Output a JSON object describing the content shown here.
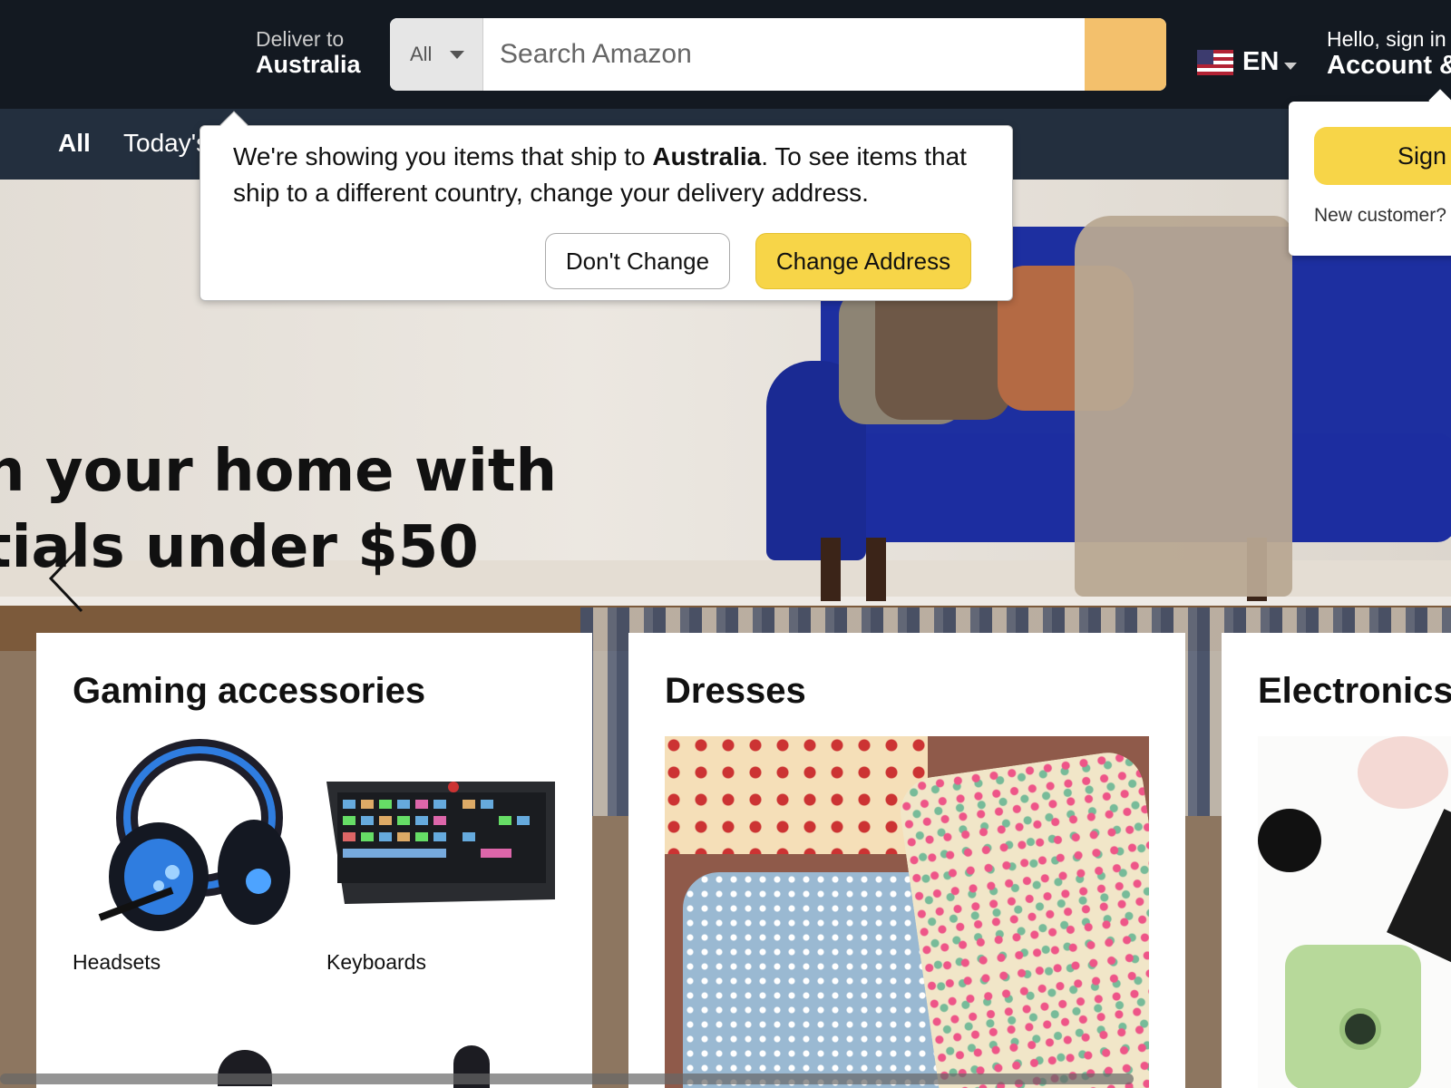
{
  "header": {
    "deliver_label": "Deliver to",
    "deliver_country": "Australia",
    "search": {
      "category": "All",
      "placeholder": "Search Amazon"
    },
    "language": "EN",
    "account_greeting": "Hello, sign in",
    "account_label": "Account &"
  },
  "subnav": {
    "all": "All",
    "todays": "Today's"
  },
  "hero": {
    "line1": "h your home with",
    "line2": "tials under $50"
  },
  "location_popover": {
    "message_before": "We're showing you items that ship to ",
    "country": "Australia",
    "message_after": ". To see items that ship to a different country, change your delivery address.",
    "dont_change": "Don't Change",
    "change_address": "Change Address"
  },
  "signin_flyout": {
    "button": "Sign in",
    "new_customer": "New customer?"
  },
  "cards": [
    {
      "title": "Gaming accessories",
      "tiles": [
        {
          "label": "Headsets"
        },
        {
          "label": "Keyboards"
        }
      ]
    },
    {
      "title": "Dresses"
    },
    {
      "title": "Electronics"
    }
  ],
  "colors": {
    "nav_dark": "#131921",
    "subnav": "#232f3e",
    "search_button": "#f3c06c",
    "primary_button": "#f7d548"
  }
}
